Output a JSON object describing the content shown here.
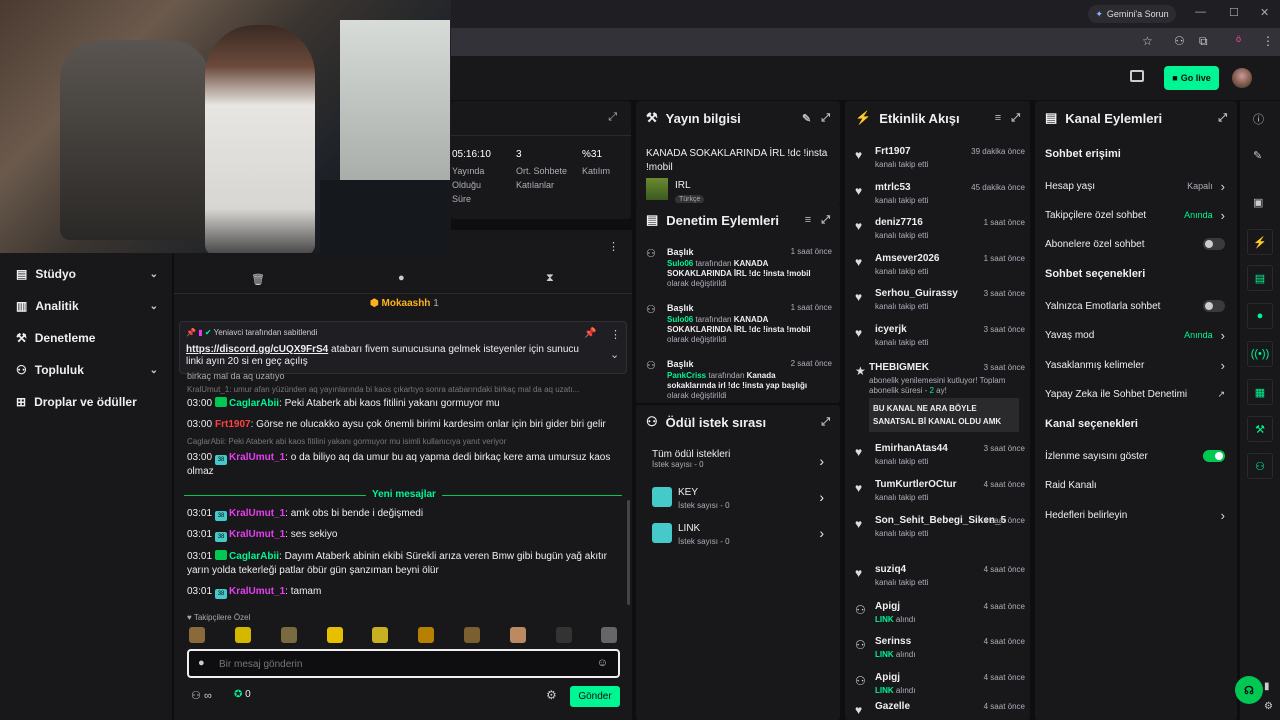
{
  "browser": {
    "gemini_label": "Gemini'a Sorun",
    "profile_initial": "ö"
  },
  "appbar": {
    "go_live": "Go live"
  },
  "nav": {
    "items": [
      {
        "label": "Stüdyo"
      },
      {
        "label": "Analitik"
      },
      {
        "label": "Denetleme"
      },
      {
        "label": "Topluluk"
      },
      {
        "label": "Droplar ve ödüller"
      }
    ]
  },
  "stats": [
    {
      "value": "05:16:10",
      "label": "Yayında Olduğu Süre"
    },
    {
      "value": "3",
      "label": "Ort. Sohbete Katılanlar"
    },
    {
      "value": "%31",
      "label": "Katılım"
    }
  ],
  "chat": {
    "top_user": "Mokaashh",
    "top_count": "1",
    "pinned_by": "Yeniavci tarafından sabitlendi",
    "pinned_link": "https://discord.gg/cUQX9FrS4",
    "pinned_text": " atabarı fivem sunucusuna gelmek isteyenler için sunucu linki ayın 20 si en geç açılış",
    "cut_line": "birkaç mal da aq uzatıyo",
    "messages": [
      {
        "reply": "KralUmut_1: umur afan yüzünden aq yayınlarında bi kaos çıkartıyo sonra atabarındaki birkaç mal da aq uzatı...",
        "time": "03:00",
        "badge": "",
        "user": "CaglarAbii",
        "color": "#00f593",
        "text": "Peki Ataberk abi kaos fitilini yakanı gormuyor mu"
      },
      {
        "reply": "",
        "time": "03:00",
        "badge": "",
        "user": "Frt1907",
        "color": "#ff4040",
        "text": "Görse ne olucakko aysu çok önemli birimi kardesim onlar için biri gider biri gelir"
      },
      {
        "reply": "CaglarAbii: Peki Ataberk abi kaos fitilini yakanı gormuyor mu isimli kullanıcıya yanıt veriyor",
        "time": "03:00",
        "badge": "38",
        "user": "KralUmut_1",
        "color": "#e63df2",
        "text": "o da biliyo aq da umur bu aq yapma dedi birkaç kere ama umursuz kaos olmaz"
      },
      {
        "reply": "",
        "time": "03:01",
        "badge": "38",
        "user": "KralUmut_1",
        "color": "#e63df2",
        "text": "amk obs bi bende i değişmedi"
      },
      {
        "reply": "",
        "time": "03:01",
        "badge": "38",
        "user": "KralUmut_1",
        "color": "#e63df2",
        "text": "ses sekiyo"
      },
      {
        "reply": "",
        "time": "03:01",
        "badge": "",
        "user": "CaglarAbii",
        "color": "#00f593",
        "text": "Dayım Ataberk abinin ekibi Sürekli arıza veren Bmw gibi bugün yağ akıtır yarın yolda tekerleği patlar öbür gün şanzıman beyni ölür"
      },
      {
        "reply": "",
        "time": "03:01",
        "badge": "38",
        "user": "KralUmut_1",
        "color": "#e63df2",
        "text": "tamam"
      }
    ],
    "new_messages": "Yeni mesajlar",
    "followers_only": "Takipçilere Özel",
    "placeholder": "Bir mesaj gönderin",
    "points": "0",
    "send": "Gönder",
    "infinity": "∞"
  },
  "yayin": {
    "title": "Yayın bilgisi",
    "stream_title": "KANADA SOKAKLARINDA İRL !dc !insta !mobil",
    "category": "IRL",
    "tag": "Türkçe"
  },
  "denetim": {
    "title": "Denetim Eylemleri",
    "items": [
      {
        "head": "Başlık",
        "time": "1 saat önce",
        "user": "Sulo06",
        "pre": " tarafından ",
        "val": "KANADA SOKAKLARINDA İRL !dc !insta !mobil",
        "post": " olarak değiştirildi"
      },
      {
        "head": "Başlık",
        "time": "1 saat önce",
        "user": "Sulo06",
        "pre": " tarafından ",
        "val": "KANADA SOKAKLARINDA İRL !dc !insta !mobil",
        "post": " olarak değiştirildi"
      },
      {
        "head": "Başlık",
        "time": "2 saat önce",
        "user": "PankCriss",
        "pre": " tarafından ",
        "val": "Kanada sokaklarında irl !dc !insta yap başlığı",
        "post": " olarak değiştirildi"
      }
    ]
  },
  "odul": {
    "title": "Ödül istek sırası",
    "all": "Tüm ödül istekleri",
    "all_count": "İstek sayısı - 0",
    "items": [
      {
        "name": "KEY",
        "count": "İstek sayısı - 0"
      },
      {
        "name": "LINK",
        "count": "İstek sayısı - 0"
      }
    ]
  },
  "etkinlik": {
    "title": "Etkinlik Akışı",
    "events": [
      {
        "name": "Frt1907",
        "sub": "kanalı takip etti",
        "time": "39 dakika önce"
      },
      {
        "name": "mtrlc53",
        "sub": "kanalı takip etti",
        "time": "45 dakika önce"
      },
      {
        "name": "deniz7716",
        "sub": "kanalı takip etti",
        "time": "1 saat önce"
      },
      {
        "name": "Amsever2026",
        "sub": "kanalı takip etti",
        "time": "1 saat önce"
      },
      {
        "name": "Serhou_Guirassy",
        "sub": "kanalı takip etti",
        "time": "3 saat önce"
      },
      {
        "name": "icyerjk",
        "sub": "kanalı takip etti",
        "time": "3 saat önce"
      }
    ],
    "sub_event": {
      "name": "THEBIGMEK",
      "time": "3 saat önce",
      "line1": "abonelik yenilemesini kutluyor! Toplam",
      "line2_pre": "abonelik süresi - ",
      "line2_val": "2",
      "line2_post": " ay!",
      "message": "BU KANAL NE ARA BÖYLE SANATSAL Bİ KANAL OLDU AMK"
    },
    "events2": [
      {
        "name": "EmirhanAtas44",
        "sub": "kanalı takip etti",
        "time": "3 saat önce"
      },
      {
        "name": "TumKurtlerOCtur",
        "sub": "kanalı takip etti",
        "time": "4 saat önce"
      },
      {
        "name": "Son_Sehit_Bebegi_Siken_5",
        "sub": "kanalı takip etti",
        "time": "4 saat önce"
      },
      {
        "name": "suziq4",
        "sub": "kanalı takip etti",
        "time": "4 saat önce"
      },
      {
        "name": "Apigj",
        "sub_val": "LINK",
        "sub": " alındı",
        "time": "4 saat önce"
      },
      {
        "name": "Serinss",
        "sub_val": "LINK",
        "sub": " alındı",
        "time": "4 saat önce"
      },
      {
        "name": "Apigj",
        "sub_val": "LINK",
        "sub": " alındı",
        "time": "4 saat önce"
      },
      {
        "name": "Gazelle",
        "sub": "",
        "time": "4 saat önce"
      }
    ]
  },
  "kanal": {
    "title": "Kanal Eylemleri",
    "sec1": "Sohbet erişimi",
    "rows1": [
      {
        "label": "Hesap yaşı",
        "value": "Kapalı"
      },
      {
        "label": "Takipçilere özel sohbet",
        "value": "Anında"
      },
      {
        "label": "Abonelere özel sohbet",
        "value": ""
      }
    ],
    "sec2": "Sohbet seçenekleri",
    "rows2": [
      {
        "label": "Yalnızca Emotlarla sohbet",
        "value": ""
      },
      {
        "label": "Yavaş mod",
        "value": "Anında"
      },
      {
        "label": "Yasaklanmış kelimeler",
        "value": ""
      },
      {
        "label": "Yapay Zeka ile Sohbet Denetimi",
        "value": ""
      }
    ],
    "sec3": "Kanal seçenekleri",
    "rows3": [
      {
        "label": "İzlenme sayısını göster",
        "value": ""
      },
      {
        "label": "Raid Kanalı",
        "value": ""
      },
      {
        "label": "Hedefleri belirleyin",
        "value": ""
      }
    ]
  }
}
